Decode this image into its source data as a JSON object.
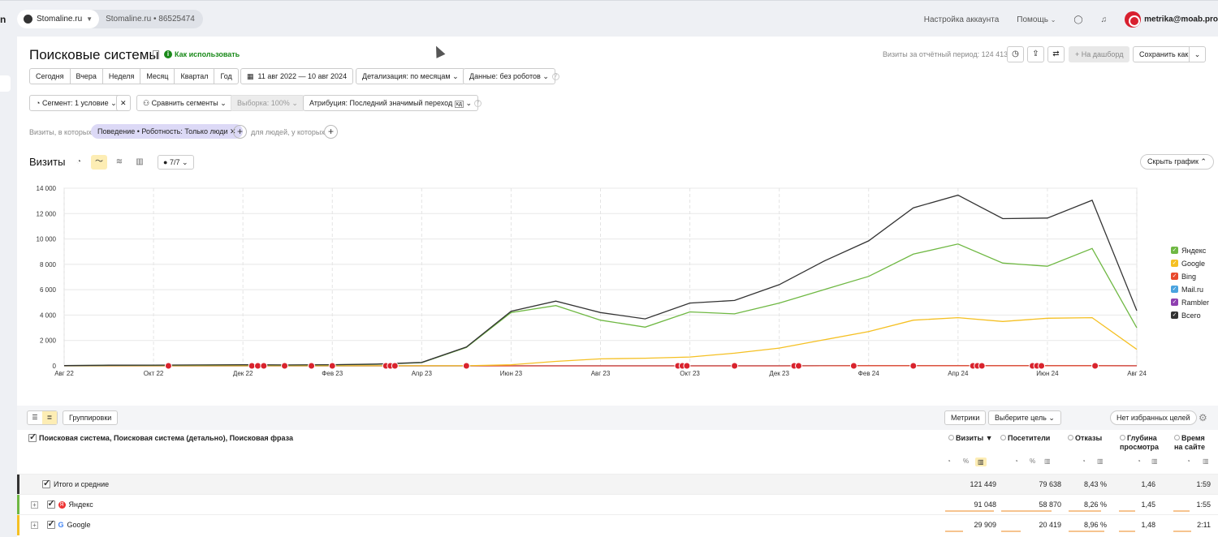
{
  "topbar": {
    "site_name": "Stomaline.ru",
    "counter": "Stomaline.ru  •  86525474",
    "account_settings": "Настройка аккаунта",
    "help": "Помощь",
    "user": "metrika@moab.pro",
    "left_edge_char": "n"
  },
  "report": {
    "title": "Поисковые системы",
    "howto": "Как использовать",
    "visits_period": "Визиты за отчётный период: 124 413",
    "to_dashboard": "+ На дашборд",
    "save_as": "Сохранить как",
    "periods": [
      "Сегодня",
      "Вчера",
      "Неделя",
      "Месяц",
      "Квартал",
      "Год"
    ],
    "date_range": "11 авг 2022 — 10 авг 2024",
    "detail": "Детализация: по месяцам",
    "data_mode": "Данные: без роботов",
    "segment": "Сегмент: 1 условие",
    "compare": "Сравнить сегменты",
    "sample": "Выборка: 100%",
    "attribution": "Атрибуция: Последний значимый переход",
    "attribution_badge": "кд",
    "filter_prefix": "Визиты, в которых",
    "filter_chip": "Поведение • Роботность: Только люди",
    "filter_suffix": "для людей, у которых"
  },
  "chart": {
    "title": "Визиты",
    "comments": "7/7",
    "hide": "Скрыть график"
  },
  "chart_data": {
    "type": "line",
    "x": [
      "Авг 22",
      "Сен 22",
      "Окт 22",
      "Ноя 22",
      "Дек 22",
      "Янв 23",
      "Фев 23",
      "Мар 23",
      "Апр 23",
      "Май 23",
      "Июн 23",
      "Июл 23",
      "Авг 23",
      "Сен 23",
      "Окт 23",
      "Ноя 23",
      "Дек 23",
      "Янв 24",
      "Фев 24",
      "Мар 24",
      "Апр 24",
      "Май 24",
      "Июн 24",
      "Июл 24",
      "Авг 24"
    ],
    "x_tick_labels": [
      "Авг 22",
      "Окт 22",
      "Дек 22",
      "Фев 23",
      "Апр 23",
      "Июн 23",
      "Авг 23",
      "Окт 23",
      "Дек 23",
      "Фев 24",
      "Апр 24",
      "Июн 24",
      "Авг 24"
    ],
    "y_ticks": [
      0,
      2000,
      4000,
      6000,
      8000,
      10000,
      12000,
      14000
    ],
    "y_tick_labels": [
      "0",
      "2 000",
      "4 000",
      "6 000",
      "8 000",
      "10 000",
      "12 000",
      "14 000"
    ],
    "ylim": [
      0,
      14000
    ],
    "series": [
      {
        "name": "Яндекс",
        "color": "#6fb843",
        "values": [
          20,
          40,
          50,
          60,
          70,
          60,
          80,
          120,
          250,
          1450,
          4200,
          4750,
          3600,
          3050,
          4250,
          4100,
          4950,
          6000,
          7050,
          8800,
          9600,
          8100,
          7850,
          9250,
          3000
        ]
      },
      {
        "name": "Google",
        "color": "#f5c023",
        "values": [
          5,
          5,
          5,
          5,
          5,
          5,
          5,
          5,
          5,
          5,
          80,
          350,
          550,
          600,
          700,
          1000,
          1400,
          2050,
          2700,
          3600,
          3800,
          3500,
          3750,
          3800,
          1300
        ]
      },
      {
        "name": "Bing",
        "color": "#e8492d",
        "values": [
          0,
          0,
          0,
          0,
          0,
          0,
          0,
          0,
          0,
          0,
          0,
          0,
          0,
          0,
          0,
          0,
          0,
          5,
          10,
          10,
          10,
          10,
          10,
          10,
          5
        ]
      },
      {
        "name": "Mail.ru",
        "color": "#4aa3df",
        "values": [
          0,
          0,
          0,
          0,
          0,
          0,
          0,
          0,
          0,
          0,
          5,
          5,
          5,
          5,
          5,
          5,
          5,
          10,
          10,
          10,
          10,
          10,
          10,
          10,
          5
        ]
      },
      {
        "name": "Rambler",
        "color": "#8e3fb0",
        "values": [
          0,
          0,
          0,
          0,
          0,
          0,
          0,
          0,
          0,
          0,
          0,
          0,
          0,
          0,
          0,
          0,
          0,
          5,
          5,
          5,
          5,
          5,
          5,
          5,
          0
        ]
      },
      {
        "name": "Всего",
        "color": "#333333",
        "values": [
          25,
          50,
          60,
          70,
          80,
          70,
          90,
          140,
          270,
          1480,
          4300,
          5100,
          4200,
          3700,
          4950,
          5150,
          6400,
          8250,
          9850,
          12450,
          13450,
          11600,
          11650,
          13050,
          4350
        ]
      }
    ],
    "grid": true,
    "legend": "right"
  },
  "table": {
    "groupings": "Группировки",
    "metrics_btn": "Метрики",
    "goal_btn": "Выберите цель",
    "fav_goals": "Нет избранных целей",
    "dimension_header": "Поисковая система, Поисковая система (детально), Поисковая фраза",
    "columns": [
      "Визиты",
      "Посетители",
      "Отказы",
      "Глубина просмотра",
      "Время на сайте"
    ],
    "rows": [
      {
        "name": "Итого и средние",
        "visits": "121 449",
        "visitors": "79 638",
        "bounce": "8,43 %",
        "depth": "1,46",
        "time": "1:59"
      },
      {
        "name": "Яндекс",
        "visits": "91 048",
        "visitors": "58 870",
        "bounce": "8,26 %",
        "depth": "1,45",
        "time": "1:55"
      },
      {
        "name": "Google",
        "visits": "29 909",
        "visitors": "20 419",
        "bounce": "8,96 %",
        "depth": "1,48",
        "time": "2:11"
      }
    ]
  }
}
